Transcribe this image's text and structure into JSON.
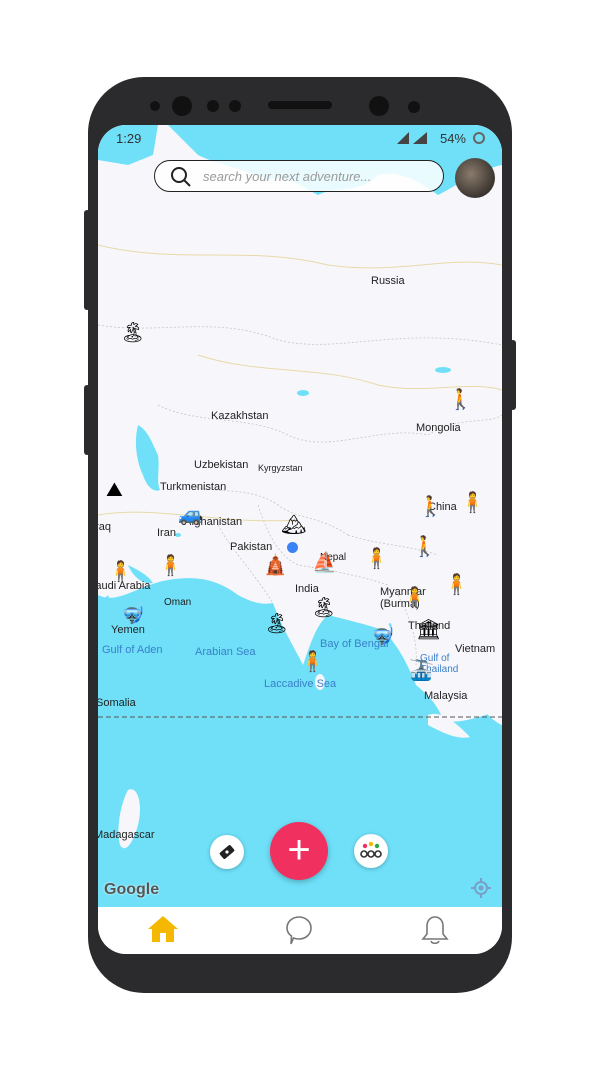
{
  "status_bar": {
    "time": "1:29",
    "battery": "54%"
  },
  "search": {
    "placeholder": "search your next adventure..."
  },
  "map": {
    "countries": [
      "Russia",
      "Kazakhstan",
      "Mongolia",
      "Uzbekistan",
      "Kyrgyzstan",
      "Turkmenistan",
      "Afghanistan",
      "Iran",
      "Pakistan",
      "Nepal",
      "China",
      "India",
      "Myanmar (Burma)",
      "Thailand",
      "Vietnam",
      "Malaysia",
      "Oman",
      "Yemen",
      "Somalia",
      "Madagascar",
      "Saudi Arabia",
      "Iraq"
    ],
    "seas": [
      "Arabian Sea",
      "Bay of Bengal",
      "Gulf of Aden",
      "Laccadive Sea",
      "Gulf of Thailand"
    ],
    "attribution": "Google"
  },
  "actions": {
    "add_symbol": "+",
    "left_icon": "ticket-icon",
    "right_icon": "community-icon"
  },
  "nav": {
    "items": [
      {
        "name": "home",
        "icon": "home-icon",
        "active": true
      },
      {
        "name": "chat",
        "icon": "chat-icon",
        "active": false
      },
      {
        "name": "notifications",
        "icon": "bell-icon",
        "active": false
      }
    ]
  },
  "colors": {
    "accent": "#f0305f",
    "water": "#6fe0f8",
    "land": "#f7f7fb",
    "nav_active": "#f5b800"
  }
}
